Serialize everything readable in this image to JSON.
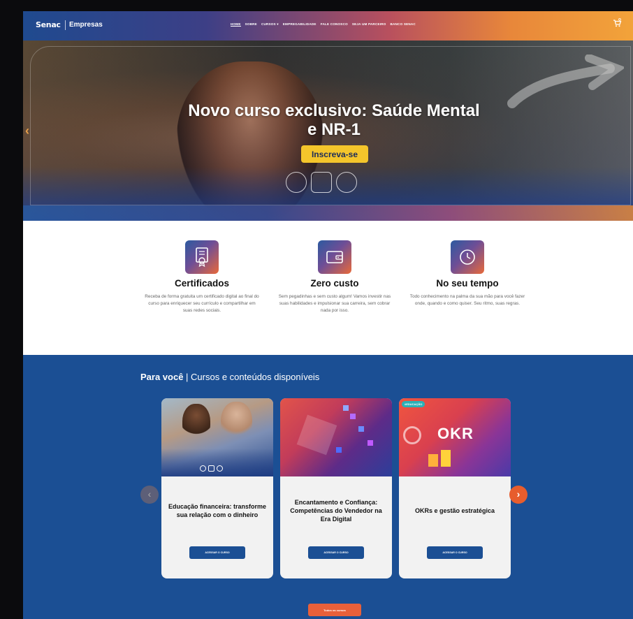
{
  "header": {
    "logo": "Senac",
    "brand": "Empresas",
    "nav": [
      "HOME",
      "SOBRE",
      "CURSOS ▾",
      "EMPREGABILIDADE",
      "FALE CONOSCO",
      "SEJA UM PARCEIRO",
      "BANCO SENAC"
    ],
    "cart_icon": "cart-icon"
  },
  "hero": {
    "title": "Novo curso exclusivo: Saúde Mental e NR-1",
    "cta": "Inscreva-se",
    "prev_icon": "chevron-left-icon"
  },
  "features": [
    {
      "icon": "certificate-icon",
      "title": "Certificados",
      "text": "Receba de forma gratuita um certificado digital ao final do curso para enriquecer seu currículo e compartilhar em suas redes sociais."
    },
    {
      "icon": "wallet-icon",
      "title": "Zero custo",
      "text": "Sem pegadinhas e sem custo algum! Vamos investir nas suas habilidades e impulsionar sua carreira, sem cobrar nada por isso."
    },
    {
      "icon": "clock-icon",
      "title": "No seu tempo",
      "text": "Todo conhecimento na palma da sua mão para você fazer onde, quando e como quiser. Seu ritmo, suas regras."
    }
  ],
  "courses": {
    "heading_bold": "Para você",
    "heading_rest": " | Cursos e conteúdos disponíveis",
    "cards": [
      {
        "title": "Educação financeira: transforme sua relação com o dinheiro",
        "button": "ACESSAR O CURSO"
      },
      {
        "title": "Encantamento e Confiança: Competências do Vendedor na Era Digital",
        "button": "ACESSAR O CURSO"
      },
      {
        "title": "OKRs e gestão estratégica",
        "button": "ACESSAR O CURSO",
        "badge": "#EDUCAÇÃO",
        "image_text": "OKR"
      }
    ],
    "all_button": "Todos os cursos"
  }
}
